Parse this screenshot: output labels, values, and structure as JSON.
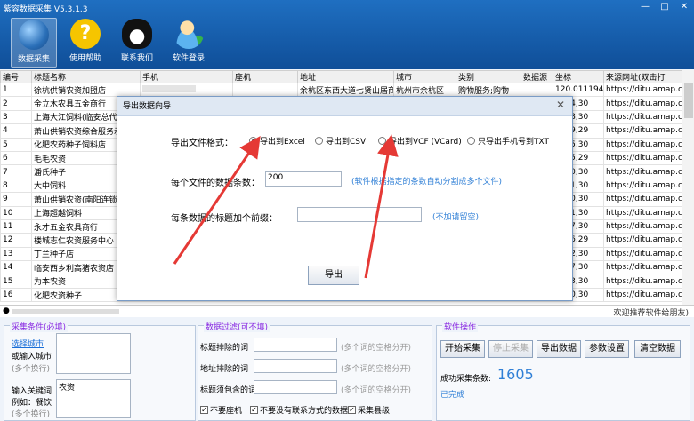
{
  "app": {
    "title": "紫容数据采集 V5.3.1.3",
    "window_controls": [
      "—",
      "□",
      "✕"
    ]
  },
  "toolbar": [
    {
      "label": "数据采集",
      "icon": "globe-icon",
      "active": true
    },
    {
      "label": "使用帮助",
      "icon": "help-icon",
      "active": false
    },
    {
      "label": "联系我们",
      "icon": "qq-penguin-icon",
      "active": false
    },
    {
      "label": "软件登录",
      "icon": "user-login-icon",
      "active": false
    }
  ],
  "table": {
    "columns": [
      "编号",
      "标题名称",
      "手机",
      "座机",
      "地址",
      "城市",
      "类别",
      "数据源",
      "坐标",
      "来源网址(双击打"
    ],
    "rows": [
      [
        "1",
        "徐杭供销农资加盟店",
        "",
        "",
        "余杭区东西大道七贤山居商",
        "杭州市余杭区",
        "购物服务;购物",
        "",
        "120.011194,30",
        "https://ditu.amap.c"
      ],
      [
        "2",
        "金立木农具五金商行",
        "",
        "",
        "",
        "",
        "",
        "",
        "5794,30",
        "https://ditu.amap.c"
      ],
      [
        "3",
        "上海大江饲料(临安总代理",
        "",
        "",
        "",
        "",
        "",
        "",
        "5948,30",
        "https://ditu.amap.c"
      ],
      [
        "4",
        "萧山供销农资综合服务示",
        "",
        "",
        "",
        "",
        "",
        "",
        "3169,29",
        "https://ditu.amap.c"
      ],
      [
        "5",
        "化肥农药种子饲料店",
        "",
        "",
        "",
        "",
        "",
        "",
        "1185,30",
        "https://ditu.amap.c"
      ],
      [
        "6",
        "毛毛农资",
        "",
        "",
        "",
        "",
        "",
        "",
        "3235,29",
        "https://ditu.amap.c"
      ],
      [
        "7",
        "潘氏种子",
        "",
        "",
        "",
        "",
        "",
        "",
        "2260,30",
        "https://ditu.amap.c"
      ],
      [
        "8",
        "大中饲料",
        "",
        "",
        "",
        "",
        "",
        "",
        "5021,30",
        "https://ditu.amap.c"
      ],
      [
        "9",
        "萧山供销农资(南阳连锁店",
        "",
        "",
        "",
        "",
        "",
        "",
        "1650,30",
        "https://ditu.amap.c"
      ],
      [
        "10",
        "上海超越饲料",
        "",
        "",
        "",
        "",
        "",
        "",
        "1691,30",
        "https://ditu.amap.c"
      ],
      [
        "11",
        "永才五金农具商行",
        "",
        "",
        "",
        "",
        "",
        "",
        "2687,30",
        "https://ditu.amap.c"
      ],
      [
        "12",
        "楼城志仁农资服务中心",
        "",
        "",
        "",
        "",
        "",
        "",
        "1496,29",
        "https://ditu.amap.c"
      ],
      [
        "13",
        "丁兰种子店",
        "",
        "",
        "",
        "",
        "",
        "",
        "7202,30",
        "https://ditu.amap.c"
      ],
      [
        "14",
        "临安西乡利高猪农资店",
        "",
        "",
        "",
        "",
        "",
        "",
        "0607,30",
        "https://ditu.amap.c"
      ],
      [
        "15",
        "为本农资",
        "",
        "",
        "",
        "",
        "",
        "",
        "1913,30",
        "https://ditu.amap.c"
      ],
      [
        "16",
        "化肥农资种子",
        "",
        "",
        "",
        "",
        "",
        "",
        "2260,30",
        "https://ditu.amap.c"
      ]
    ]
  },
  "status_bar": {
    "welcome": "欢迎推荐软件给朋友)"
  },
  "collect_conditions": {
    "title": "采集条件(必填)",
    "select_city_link": "选择城市",
    "city_label": "或输入城市",
    "city_hint": "(多个换行)",
    "keyword_label": "输入关键词",
    "keyword_example": "例如：餐饮",
    "keyword_hint": "(多个换行)",
    "keyword_value": "农资"
  },
  "data_filter": {
    "title": "数据过滤(可不填)",
    "exclude_title_label": "标题排除的词",
    "exclude_address_label": "地址排除的词",
    "must_contain_label": "标题须包含的词",
    "hint": "(多个词的空格分开)",
    "checkboxes": [
      {
        "label": "不要座机",
        "checked": true
      },
      {
        "label": "不要没有联系方式的数据",
        "checked": true
      },
      {
        "label": "采集县级",
        "checked": true
      }
    ]
  },
  "operations": {
    "title": "软件操作",
    "buttons": [
      {
        "label": "开始采集",
        "enabled": true
      },
      {
        "label": "停止采集",
        "enabled": false
      },
      {
        "label": "导出数据",
        "enabled": true
      },
      {
        "label": "参数设置",
        "enabled": true
      },
      {
        "label": "清空数据",
        "enabled": true
      }
    ],
    "success_label": "成功采集条数:",
    "success_count": "1605",
    "status": "已完成"
  },
  "dialog": {
    "title": "导出数据向导",
    "close": "✕",
    "format_label": "导出文件格式：",
    "formats": [
      {
        "label": "导出到Excel",
        "selected": true
      },
      {
        "label": "导出到CSV",
        "selected": false
      },
      {
        "label": "导出到VCF (VCard)",
        "selected": false
      },
      {
        "label": "只导出手机号到TXT",
        "selected": false
      }
    ],
    "count_label": "每个文件的数据条数：",
    "count_value": "200",
    "count_hint": "(软件根据指定的条数自动分割成多个文件)",
    "prefix_label": "每条数据的标题加个前缀：",
    "prefix_value": "",
    "prefix_hint": "(不加请留空)",
    "export_button": "导出"
  },
  "colors": {
    "accent": "#2f7fd6",
    "annotation_arrow": "#e53935",
    "toolbar_bg": "#1660ae",
    "panel_title": "#8a2be2"
  }
}
